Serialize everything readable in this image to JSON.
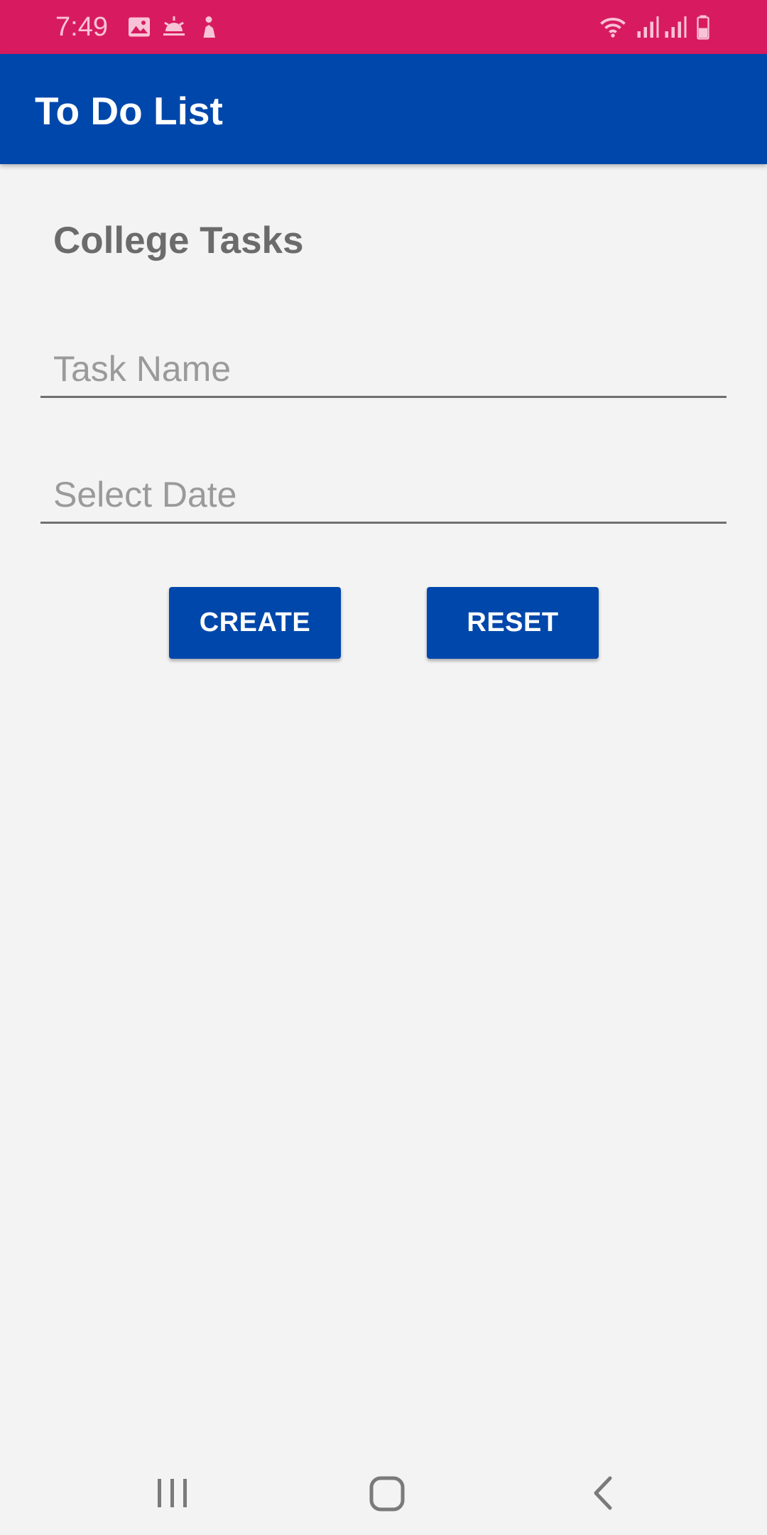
{
  "status_bar": {
    "time": "7:49",
    "left_icons": [
      "image-icon",
      "sunrise-icon",
      "person-icon"
    ],
    "right_icons": [
      "wifi-icon",
      "signal-icon",
      "signal-icon",
      "battery-icon"
    ],
    "color": "#d81b60"
  },
  "app_bar": {
    "title": "To Do List",
    "color": "#0047ab"
  },
  "main": {
    "heading": "College Tasks",
    "task_name": {
      "value": "",
      "placeholder": "Task Name"
    },
    "select_date": {
      "value": "",
      "placeholder": "Select Date"
    },
    "create_label": "CREATE",
    "reset_label": "RESET"
  },
  "nav_bar": {
    "buttons": [
      "recents-icon",
      "home-icon",
      "back-icon"
    ]
  }
}
